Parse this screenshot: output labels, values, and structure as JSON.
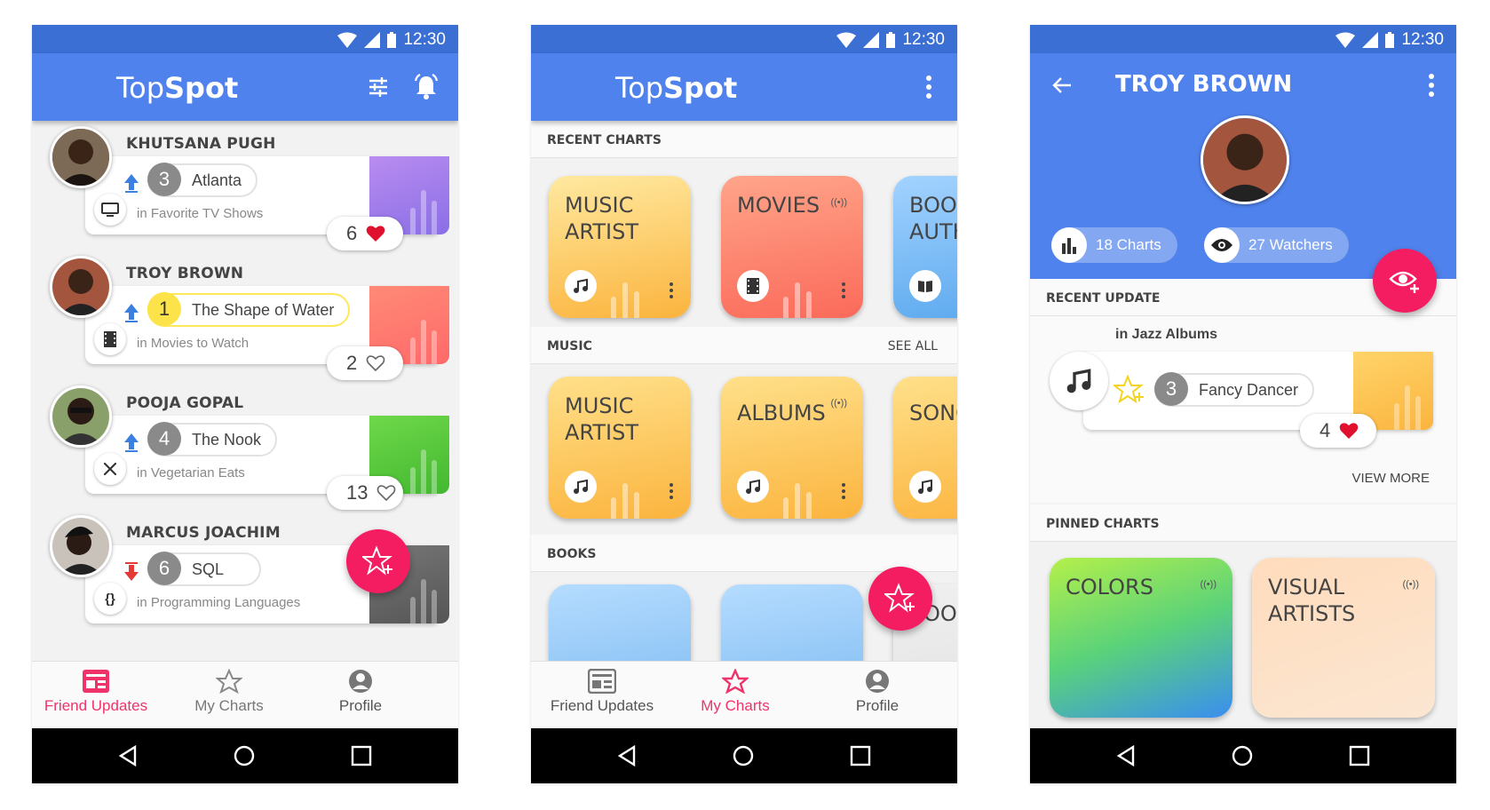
{
  "status": {
    "time": "12:30"
  },
  "app": {
    "brand_top": "Top",
    "brand_spot": "Spot"
  },
  "colors": {
    "primary": "#4f82ec",
    "accent": "#f51d62",
    "active": "#f0326a"
  },
  "bottom_nav": [
    {
      "label": "Friend Updates",
      "icon": "friend-updates-icon"
    },
    {
      "label": "My Charts",
      "icon": "my-charts-icon"
    },
    {
      "label": "Profile",
      "icon": "profile-icon"
    }
  ],
  "feed": [
    {
      "name": "KHUTSANA PUGH",
      "rank": "3",
      "item": "Atlanta",
      "context": "in Favorite TV Shows",
      "likes": "6",
      "liked": true,
      "trend": "up",
      "category_icon": "tv-icon"
    },
    {
      "name": "TROY BROWN",
      "rank": "1",
      "item": "The Shape of Water",
      "context": "in Movies to Watch",
      "likes": "2",
      "liked": false,
      "trend": "up",
      "category_icon": "film-icon"
    },
    {
      "name": "POOJA GOPAL",
      "rank": "4",
      "item": "The Nook",
      "context": "in Vegetarian Eats",
      "likes": "13",
      "liked": false,
      "trend": "up",
      "category_icon": "utensils-icon"
    },
    {
      "name": "MARCUS JOACHIM",
      "rank": "6",
      "item": "SQL",
      "context": "in Programming Languages",
      "likes": "",
      "liked": false,
      "trend": "down",
      "category_icon": "code-braces-icon"
    }
  ],
  "charts": {
    "recent_title": "RECENT CHARTS",
    "recent": [
      {
        "line1": "MUSIC",
        "line2": "ARTIST",
        "icon": "music-note-icon"
      },
      {
        "line1": "MOVIES",
        "line2": "",
        "icon": "film-icon"
      },
      {
        "line1": "BOOK",
        "line2": "AUTH",
        "icon": "book-icon"
      }
    ],
    "music_title": "MUSIC",
    "see_all": "SEE ALL",
    "music": [
      {
        "line1": "MUSIC",
        "line2": "ARTIST",
        "icon": "music-note-icon"
      },
      {
        "line1": "ALBUMS",
        "line2": "",
        "icon": "music-note-icon"
      },
      {
        "line1": "SONG",
        "line2": "",
        "icon": "music-note-icon"
      }
    ],
    "books_title": "BOOKS",
    "books": [
      {
        "line1": ""
      },
      {
        "line1": ""
      },
      {
        "line1": "BOOK"
      }
    ]
  },
  "profile": {
    "name": "TROY BROWN",
    "charts_count": "18 Charts",
    "watchers": "27 Watchers",
    "recent_update_title": "RECENT UPDATE",
    "update_context": "in Jazz Albums",
    "update_rank": "3",
    "update_item": "Fancy Dancer",
    "update_likes": "4",
    "view_more": "VIEW MORE",
    "pinned_title": "PINNED CHARTS",
    "pinned": [
      {
        "line1": "COLORS",
        "line2": ""
      },
      {
        "line1": "VISUAL",
        "line2": "ARTISTS"
      }
    ]
  }
}
